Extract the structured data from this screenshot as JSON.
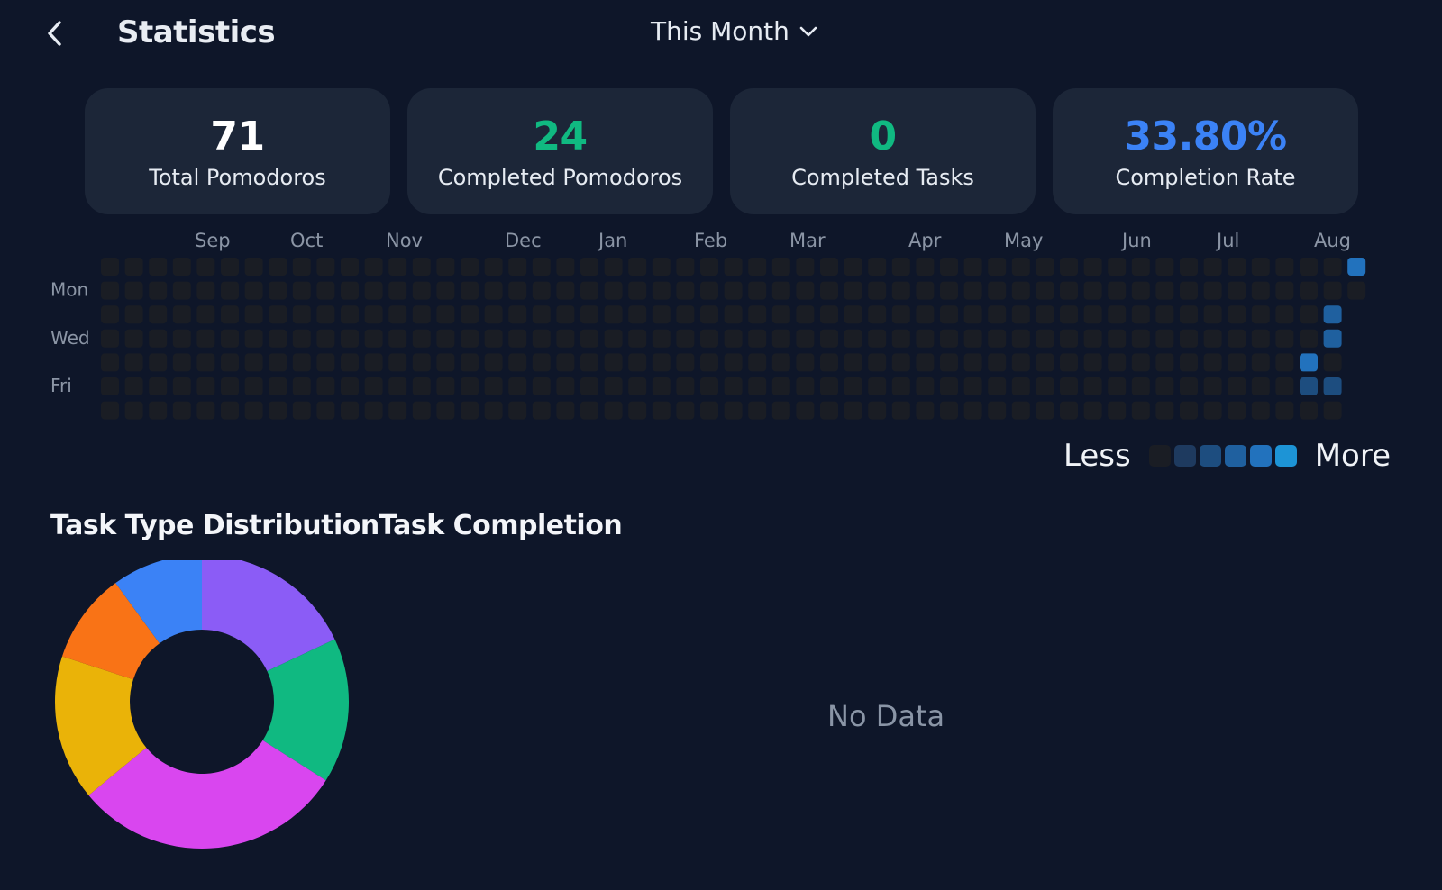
{
  "header": {
    "back_icon": "chevron-left-icon",
    "title": "Statistics",
    "range_selector": {
      "label": "This Month",
      "icon": "chevron-down-icon"
    }
  },
  "summary_cards": [
    {
      "value": "71",
      "label": "Total Pomodoros",
      "color": "#ffffff"
    },
    {
      "value": "24",
      "label": "Completed Pomodoros",
      "color": "#10b981"
    },
    {
      "value": "0",
      "label": "Completed Tasks",
      "color": "#10b981"
    },
    {
      "value": "33.80%",
      "label": "Completion Rate",
      "color": "#3b82f6"
    }
  ],
  "heatmap": {
    "months": [
      "Sep",
      "Oct",
      "Nov",
      "Dec",
      "Jan",
      "Feb",
      "Mar",
      "Apr",
      "May",
      "Jun",
      "Jul",
      "Aug"
    ],
    "day_labels": [
      "Mon",
      "Wed",
      "Fri"
    ],
    "legend_less": "Less",
    "legend_more": "More",
    "level_colors": [
      "#1a1d24",
      "#1e3a5f",
      "#1d4d7f",
      "#1f609f",
      "#2272bd",
      "#1d94d6"
    ],
    "active_cells": [
      {
        "week": 52,
        "day": 0,
        "level": 4
      },
      {
        "week": 51,
        "day": 2,
        "level": 3
      },
      {
        "week": 51,
        "day": 3,
        "level": 3
      },
      {
        "week": 50,
        "day": 4,
        "level": 4
      },
      {
        "week": 50,
        "day": 5,
        "level": 2
      },
      {
        "week": 51,
        "day": 5,
        "level": 2
      }
    ]
  },
  "task_type_distribution": {
    "title": "Task Type Distribution",
    "chart_data": {
      "type": "pie",
      "slices": [
        {
          "value": 18,
          "color": "#8b5cf6"
        },
        {
          "value": 16,
          "color": "#10b981"
        },
        {
          "value": 30,
          "color": "#d946ef"
        },
        {
          "value": 16,
          "color": "#eab308"
        },
        {
          "value": 10,
          "color": "#f97316"
        },
        {
          "value": 10,
          "color": "#3b82f6"
        }
      ]
    }
  },
  "task_completion": {
    "title": "Task Completion",
    "empty_text": "No Data"
  }
}
